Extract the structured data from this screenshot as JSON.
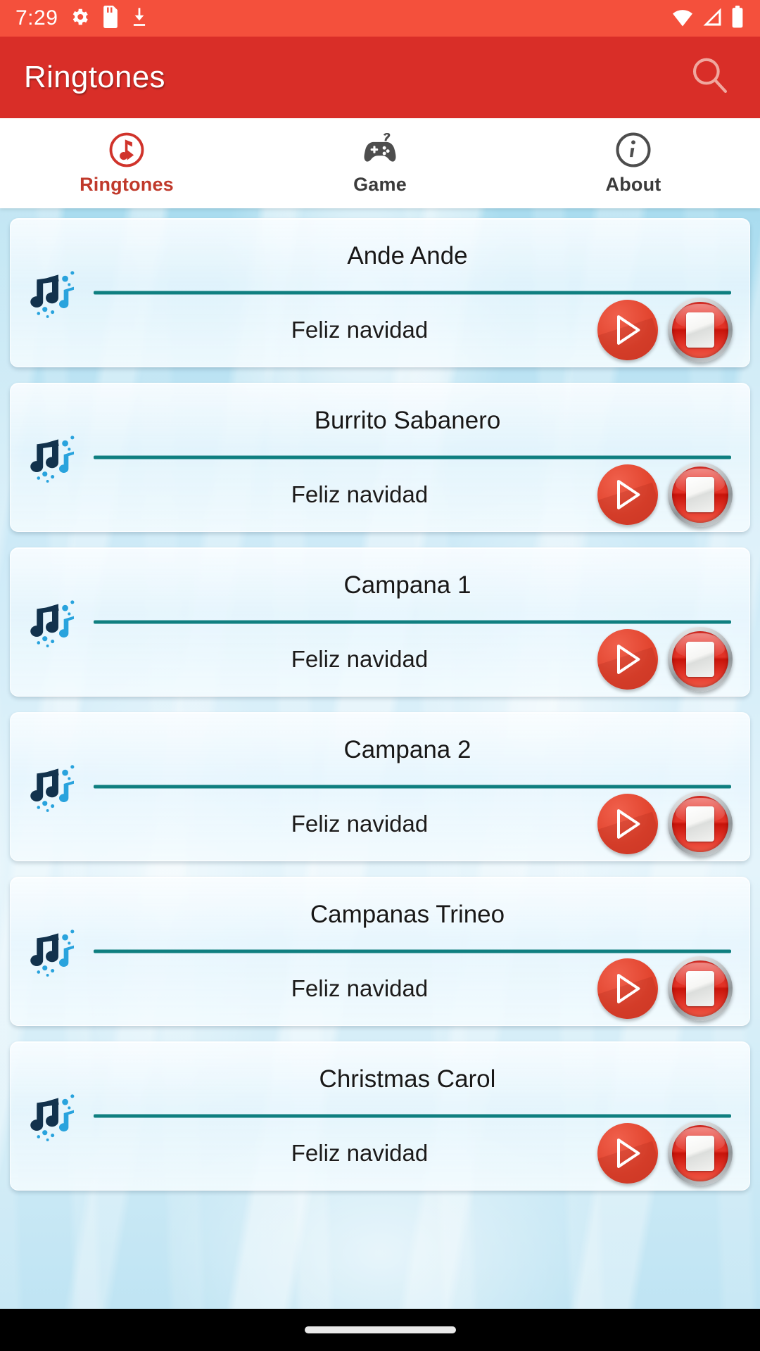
{
  "status_bar": {
    "time": "7:29",
    "left_icons": [
      "gear-icon",
      "sd-card-icon",
      "download-icon"
    ],
    "right_icons": [
      "wifi-icon",
      "signal-icon",
      "battery-icon"
    ],
    "background_color": "#f4503c"
  },
  "app_bar": {
    "title": "Ringtones",
    "search_icon": "search-icon",
    "background_color": "#d92e28",
    "title_color": "#ffffff"
  },
  "tabs": {
    "active_index": 0,
    "active_color": "#c0392b",
    "inactive_color": "#3b3b3b",
    "items": [
      {
        "label": "Ringtones",
        "icon": "music-ringtone-circle-icon"
      },
      {
        "label": "Game",
        "icon": "gamepad-icon"
      },
      {
        "label": "About",
        "icon": "info-circle-icon"
      }
    ]
  },
  "list": {
    "divider_color": "#0f7f80",
    "play_button_color": "#e2452f",
    "stop_button_color": "#e23226",
    "items": [
      {
        "title": "Ande Ande",
        "subtitle": "Feliz navidad",
        "icon": "music-notes-icon",
        "play_label": "play-button",
        "stop_label": "stop-button"
      },
      {
        "title": "Burrito Sabanero",
        "subtitle": "Feliz navidad",
        "icon": "music-notes-icon",
        "play_label": "play-button",
        "stop_label": "stop-button"
      },
      {
        "title": "Campana 1",
        "subtitle": "Feliz navidad",
        "icon": "music-notes-icon",
        "play_label": "play-button",
        "stop_label": "stop-button"
      },
      {
        "title": "Campana 2",
        "subtitle": "Feliz navidad",
        "icon": "music-notes-icon",
        "play_label": "play-button",
        "stop_label": "stop-button"
      },
      {
        "title": "Campanas Trineo",
        "subtitle": "Feliz navidad",
        "icon": "music-notes-icon",
        "play_label": "play-button",
        "stop_label": "stop-button"
      },
      {
        "title": "Christmas Carol",
        "subtitle": "Feliz navidad",
        "icon": "music-notes-icon",
        "play_label": "play-button",
        "stop_label": "stop-button"
      }
    ]
  },
  "nav_bar": {
    "gesture_pill": "home-gesture-pill"
  }
}
